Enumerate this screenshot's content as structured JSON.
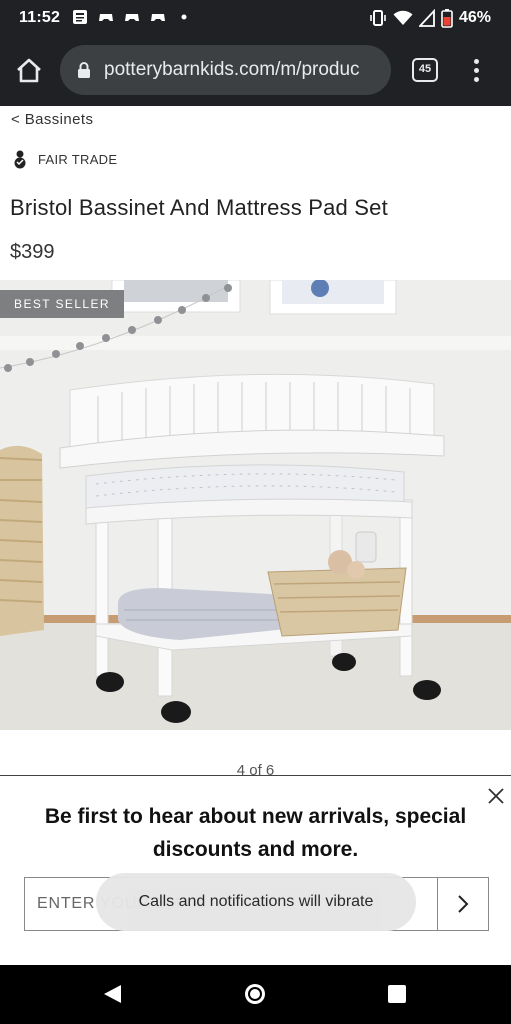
{
  "status_bar": {
    "time": "11:52",
    "battery_percent": "46%"
  },
  "browser": {
    "url": "potterybarnkids.com/m/produc",
    "tab_count": "45"
  },
  "product": {
    "breadcrumb": "< Bassinets",
    "fair_trade_label": "FAIR TRADE",
    "title": "Bristol Bassinet And Mattress Pad Set",
    "price": "$399",
    "badge": "BEST SELLER",
    "image_pager": "4 of 6"
  },
  "signup": {
    "headline": "Be first to hear about new arrivals, special discounts and more.",
    "email_placeholder": "ENTER YOUR EMAIL"
  },
  "toast": {
    "message": "Calls and notifications will vibrate"
  },
  "colors": {
    "system_bar": "#202124",
    "url_pill": "#3c4043",
    "badge": "#7d7f80",
    "toast_bg": "#e6e6e6"
  }
}
